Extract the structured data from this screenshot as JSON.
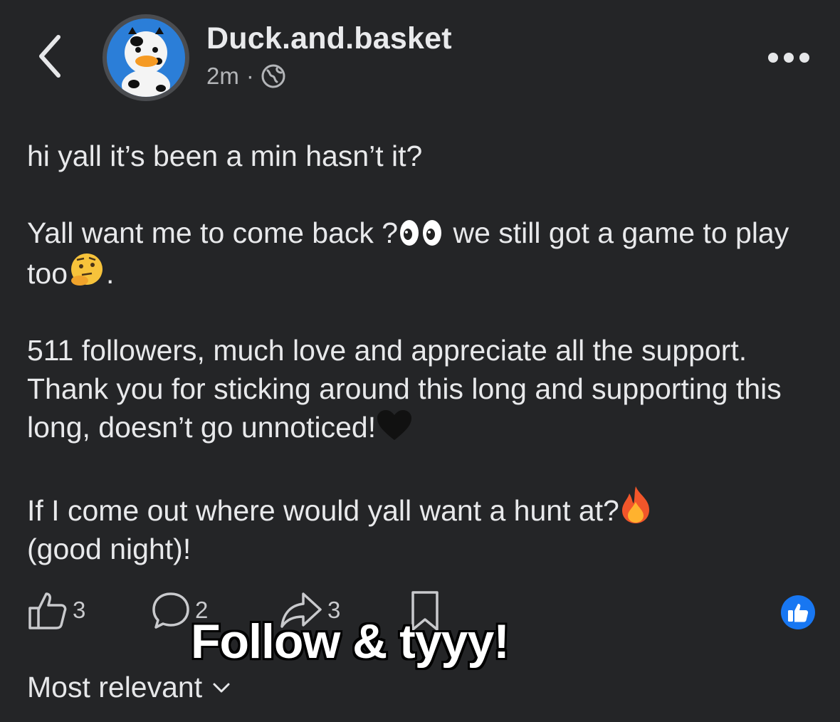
{
  "header": {
    "author": "Duck.and.basket",
    "time": "2m",
    "separator": "·",
    "back_icon": "chevron-left-icon",
    "privacy_icon": "globe-icon",
    "more_icon": "more-horizontal-icon"
  },
  "post": {
    "line1": "hi yall it’s been a min hasn’t it?",
    "line2_a": " Yall want me to come back ?",
    "line2_b": " we still got a game to play too",
    "line2_c": ".",
    "line3": "511 followers, much love and appreciate all the support. Thank you for sticking around this long and supporting this long, doesn’t go unnoticed!",
    "line4_a": "If I come out where would yall want a hunt at?",
    "line4_b": "(good night)!"
  },
  "actions": {
    "likes": "3",
    "comments": "2",
    "shares": "3"
  },
  "overlay_text": "Follow & tyyy!",
  "comments": {
    "sort_label": "Most relevant"
  },
  "colors": {
    "background": "#242527",
    "accent": "#1877f2"
  }
}
